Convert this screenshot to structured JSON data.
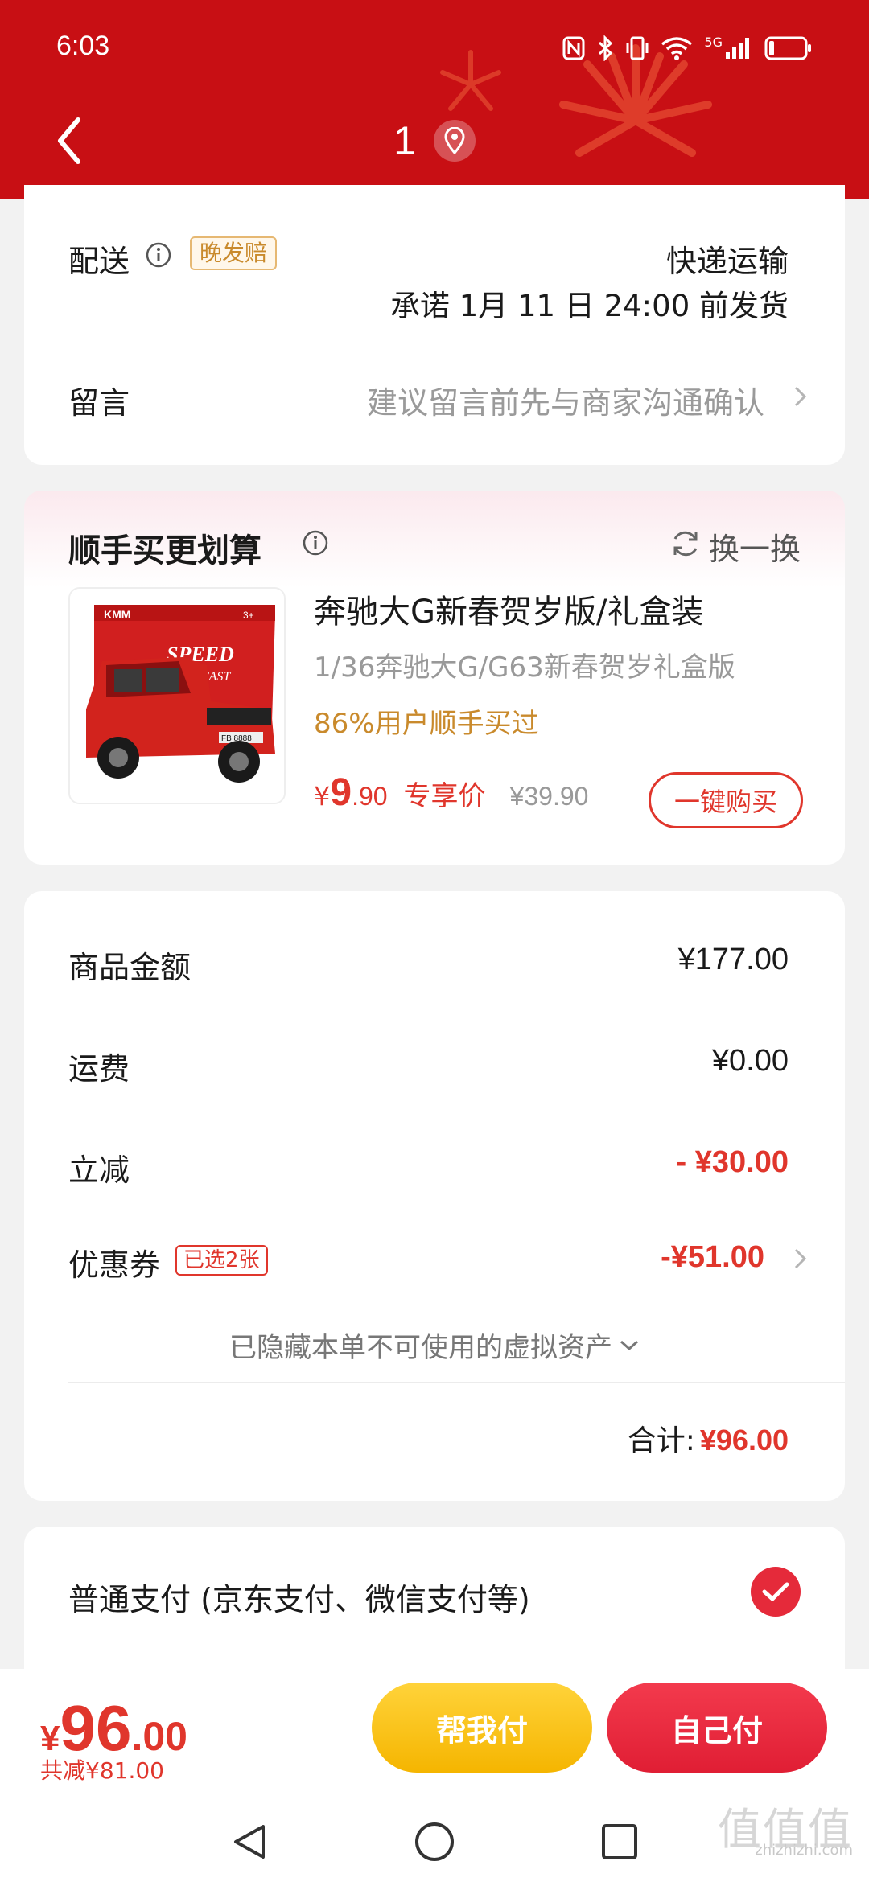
{
  "status_bar": {
    "time": "6:03",
    "network": "5G"
  },
  "header": {
    "title": "1"
  },
  "delivery": {
    "label": "配送",
    "tag": "晚发赔",
    "method": "快递运输",
    "promise": "承诺 1月 11 日 24:00 前发货"
  },
  "message": {
    "label": "留言",
    "placeholder": "建议留言前先与商家沟通确认"
  },
  "addon": {
    "title": "顺手买更划算",
    "refresh_label": "换一换",
    "product": {
      "name": "奔驰大G新春贺岁版/礼盒装",
      "subtitle": "1/36奔驰大G/G63新春贺岁礼盒版",
      "stat": "86%用户顺手买过",
      "price_symbol": "¥",
      "price_int": "9",
      "price_dec": ".90",
      "price_label": "专享价",
      "original_price": "¥39.90",
      "buy_button": "一键购买",
      "image_text": {
        "brand": "KMM",
        "speed": "SPEED",
        "diecast": "DIE-CAST",
        "plate": "FB 8888",
        "age": "3+"
      }
    }
  },
  "summary": {
    "rows": [
      {
        "label": "商品金额",
        "value": "¥177.00"
      },
      {
        "label": "运费",
        "value": "¥0.00"
      },
      {
        "label": "立减",
        "value": "- ¥30.00"
      },
      {
        "label": "优惠券",
        "tag": "已选2张",
        "value": "-¥51.00"
      }
    ],
    "hidden_note": "已隐藏本单不可使用的虚拟资产",
    "total_label": "合计:",
    "total_value": "¥96.00"
  },
  "payment": {
    "option": "普通支付 (京东支付、微信支付等)",
    "selected": true
  },
  "bottom_bar": {
    "symbol": "¥",
    "amount_int": "96",
    "amount_dec": ".00",
    "saved": "共减¥81.00",
    "help_pay": "帮我付",
    "self_pay": "自己付"
  },
  "watermark": {
    "main": "值值值",
    "sub": "zhizhizhi.com"
  },
  "colors": {
    "header": "#c80f14",
    "accent": "#e0362c",
    "help_button": "#f5b500",
    "self_button": "#e01e34"
  }
}
